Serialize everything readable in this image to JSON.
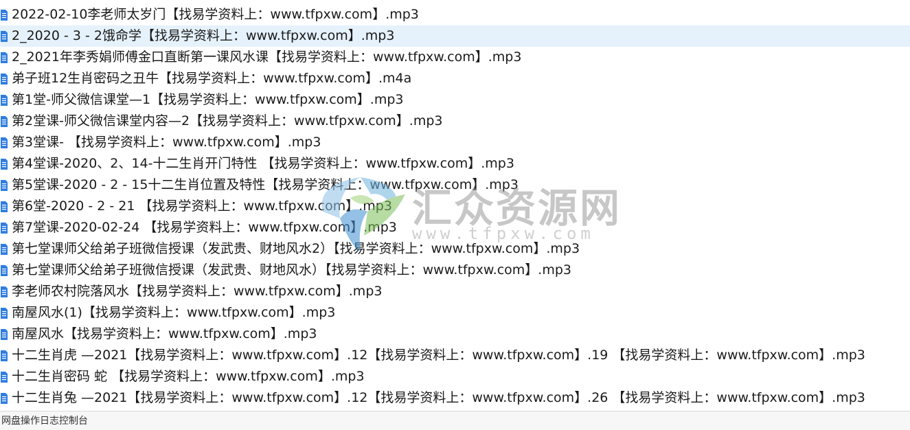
{
  "files": [
    {
      "name": "2022-02-10李老师太岁门【找易学资料上：www.tfpxw.com】.mp3",
      "selected": false
    },
    {
      "name": "2_2020 - 3 - 2饿命学【找易学资料上：www.tfpxw.com】.mp3",
      "selected": true
    },
    {
      "name": "2_2021年李秀娟师傅金口直断第一课风水课【找易学资料上：www.tfpxw.com】.mp3",
      "selected": false
    },
    {
      "name": "弟子班12生肖密码之丑牛【找易学资料上：www.tfpxw.com】.m4a",
      "selected": false
    },
    {
      "name": "第1堂-师父微信课堂—1【找易学资料上：www.tfpxw.com】.mp3",
      "selected": false
    },
    {
      "name": "第2堂课-师父微信课堂内容—2【找易学资料上：www.tfpxw.com】.mp3",
      "selected": false
    },
    {
      "name": "第3堂课- 【找易学资料上：www.tfpxw.com】.mp3",
      "selected": false
    },
    {
      "name": "第4堂课-2020、2、14-十二生肖开门特性 【找易学资料上：www.tfpxw.com】.mp3",
      "selected": false
    },
    {
      "name": "第5堂课-2020 - 2 - 15十二生肖位置及特性【找易学资料上：www.tfpxw.com】.mp3",
      "selected": false
    },
    {
      "name": "第6堂-2020 - 2 - 21 【找易学资料上：www.tfpxw.com】.mp3",
      "selected": false
    },
    {
      "name": "第7堂课-2020-02-24 【找易学资料上：www.tfpxw.com】.mp3",
      "selected": false
    },
    {
      "name": "第七堂课师父给弟子班微信授课（发武贵、财地风水2）【找易学资料上：www.tfpxw.com】.mp3",
      "selected": false
    },
    {
      "name": "第七堂课师父给弟子班微信授课（发武贵、财地风水）【找易学资料上：www.tfpxw.com】.mp3",
      "selected": false
    },
    {
      "name": "李老师农村院落风水【找易学资料上：www.tfpxw.com】.mp3",
      "selected": false
    },
    {
      "name": "南屋风水(1)【找易学资料上：www.tfpxw.com】.mp3",
      "selected": false
    },
    {
      "name": "南屋风水【找易学资料上：www.tfpxw.com】.mp3",
      "selected": false
    },
    {
      "name": "十二生肖虎 —2021【找易学资料上：www.tfpxw.com】.12【找易学资料上：www.tfpxw.com】.19 【找易学资料上：www.tfpxw.com】.mp3",
      "selected": false
    },
    {
      "name": "十二生肖密码 蛇 【找易学资料上：www.tfpxw.com】.mp3",
      "selected": false
    },
    {
      "name": "十二生肖兔 —2021【找易学资料上：www.tfpxw.com】.12【找易学资料上：www.tfpxw.com】.26 【找易学资料上：www.tfpxw.com】.mp3",
      "selected": false
    }
  ],
  "status_bar": {
    "console_tab": "网盘操作日志控制台"
  },
  "watermark": {
    "brand": "汇众资源网",
    "url": "www.tfpxw.com"
  },
  "colors": {
    "selected_row": "#e5f1fb",
    "file_icon": "#2f7de1",
    "text": "#1a1a1a"
  }
}
